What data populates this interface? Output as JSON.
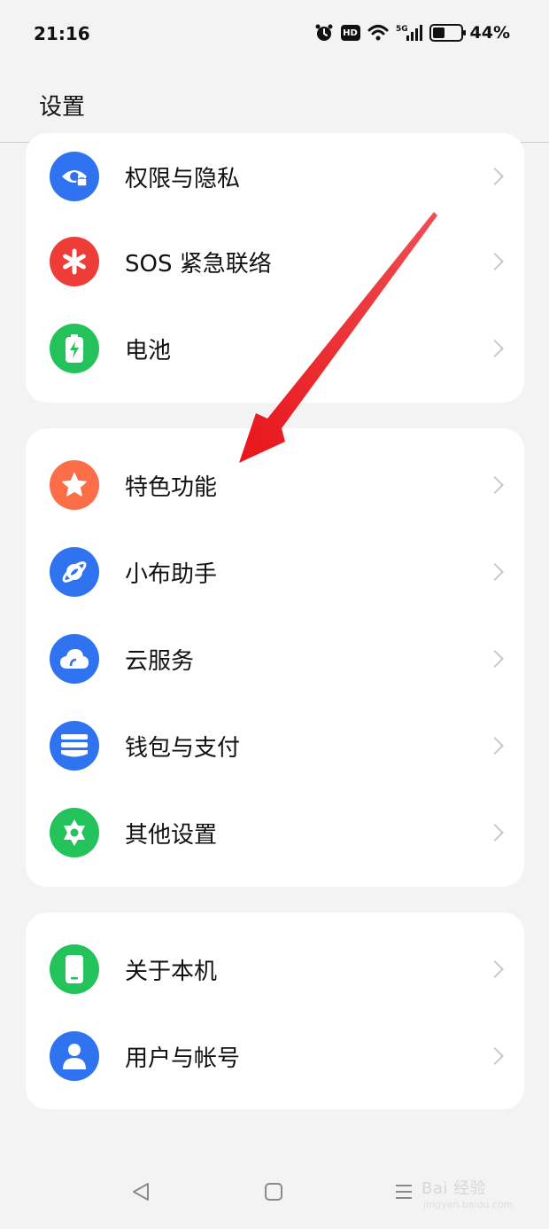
{
  "status_bar": {
    "time": "21:16",
    "network": "5G",
    "battery_percent": "44%",
    "battery_level": 0.44
  },
  "header": {
    "title": "设置"
  },
  "groups": [
    {
      "items": [
        {
          "label": "权限与隐私",
          "icon": "privacy-icon",
          "color": "#2f73f0"
        },
        {
          "label": "SOS 紧急联络",
          "icon": "sos-icon",
          "color": "#ee3c38"
        },
        {
          "label": "电池",
          "icon": "battery-icon",
          "color": "#23c25a"
        }
      ]
    },
    {
      "items": [
        {
          "label": "特色功能",
          "icon": "star-icon",
          "color": "#fb6e47"
        },
        {
          "label": "小布助手",
          "icon": "assistant-icon",
          "color": "#2f73f0"
        },
        {
          "label": "云服务",
          "icon": "cloud-icon",
          "color": "#2f73f0"
        },
        {
          "label": "钱包与支付",
          "icon": "wallet-icon",
          "color": "#2f73f0"
        },
        {
          "label": "其他设置",
          "icon": "gear-icon",
          "color": "#23c25a"
        }
      ]
    },
    {
      "items": [
        {
          "label": "关于本机",
          "icon": "phone-icon",
          "color": "#23c25a"
        },
        {
          "label": "用户与帐号",
          "icon": "user-icon",
          "color": "#2f73f0"
        }
      ]
    }
  ],
  "annotation": {
    "arrow_color": "#e8151b",
    "points_to": "特色功能"
  },
  "watermark": {
    "text": "Bai 经验",
    "sub": "jingyan.baidu.com"
  }
}
